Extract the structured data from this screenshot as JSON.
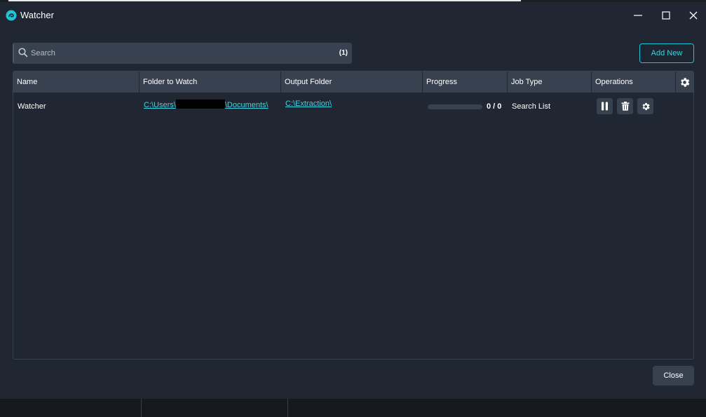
{
  "window": {
    "title": "Watcher",
    "icons": {
      "app": "watcher-logo-icon",
      "minimize": "minimize-icon",
      "maximize": "maximize-icon",
      "close": "close-icon"
    }
  },
  "toolbar": {
    "search_placeholder": "Search",
    "search_value": "",
    "result_count": "(1)",
    "add_new_label": "Add New"
  },
  "table": {
    "columns": [
      "Name",
      "Folder to Watch",
      "Output Folder",
      "Progress",
      "Job Type",
      "Operations"
    ],
    "rows": [
      {
        "name": "Watcher",
        "folder_prefix": "C:\\Users\\",
        "folder_suffix": "\\Documents\\",
        "output_folder": "C:\\Extraction\\",
        "progress_fraction": 0,
        "progress_text": "0 / 0",
        "job_type": "Search List"
      }
    ]
  },
  "footer": {
    "close_label": "Close"
  },
  "colors": {
    "accent": "#1ec6d8",
    "background": "#202732",
    "header": "#384150"
  }
}
